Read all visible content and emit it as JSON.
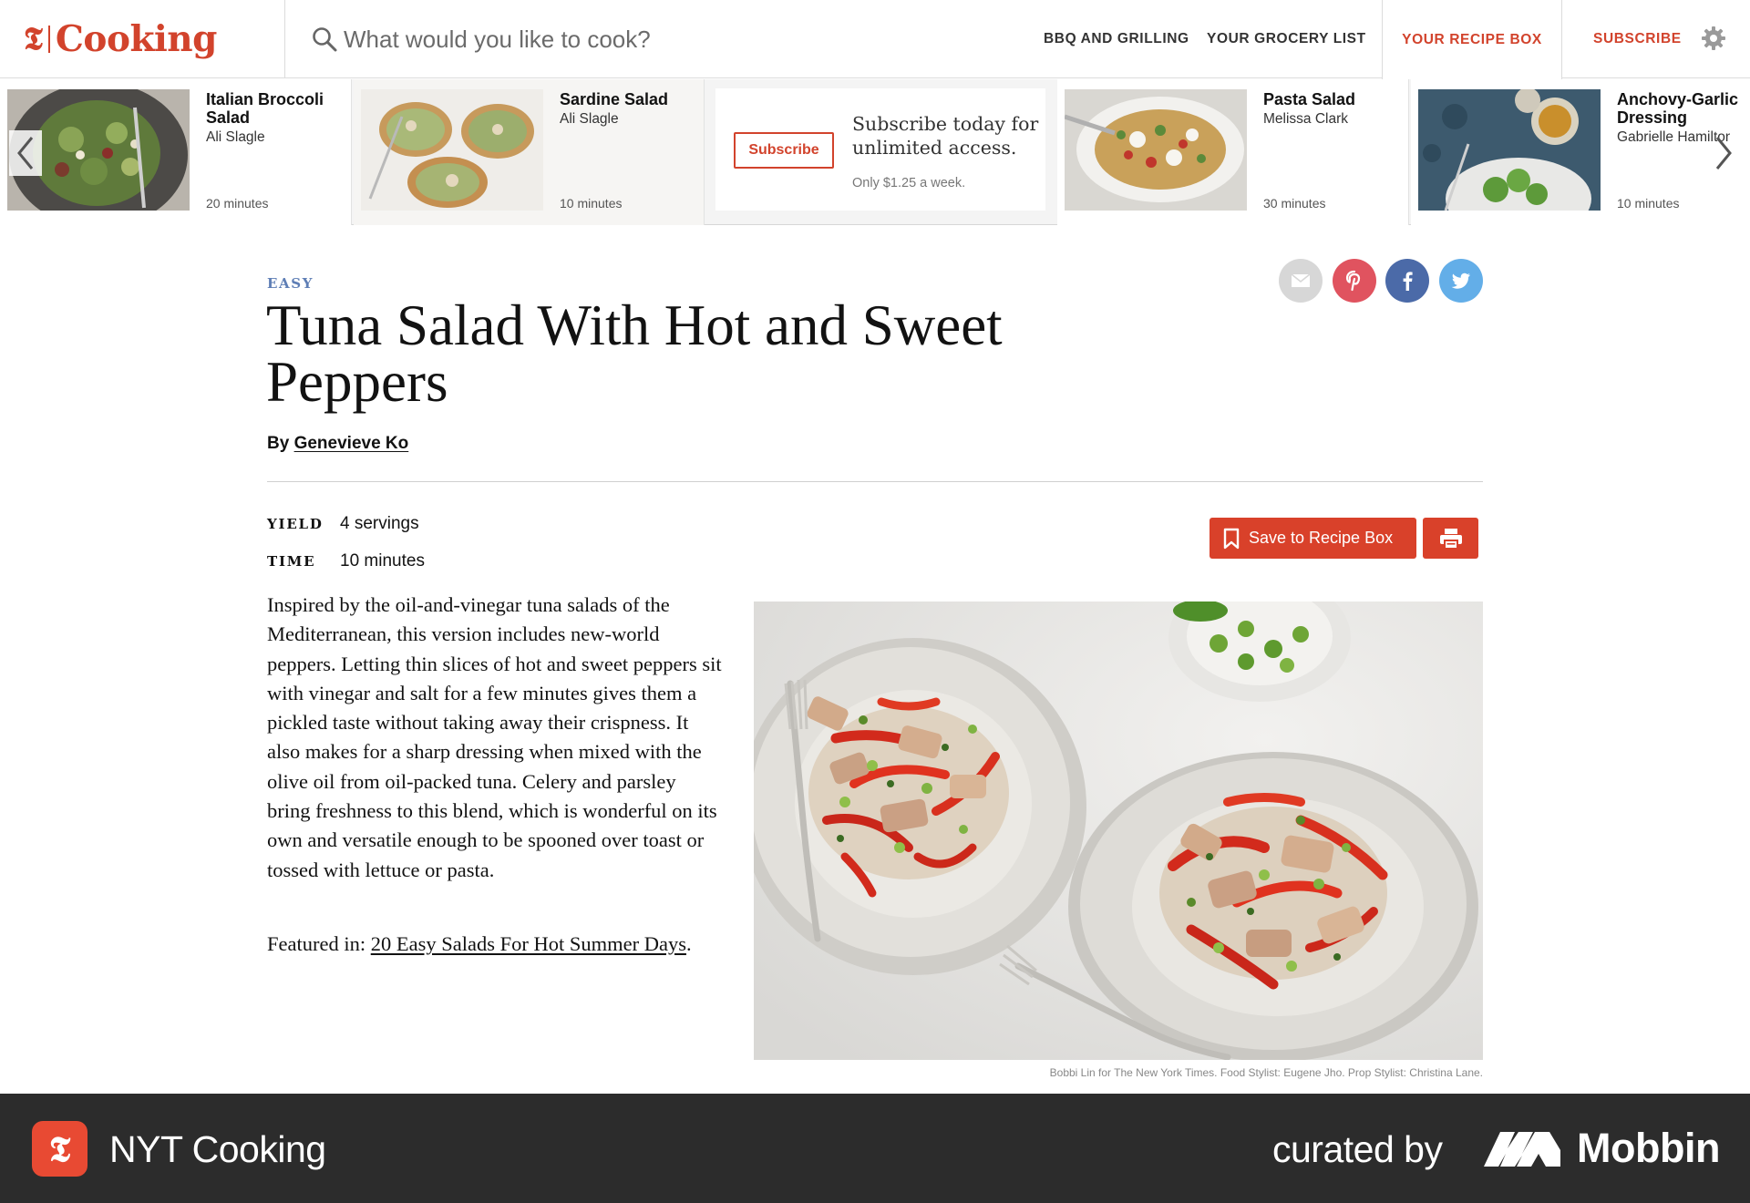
{
  "header": {
    "logo_mark": "𝕿",
    "logo_word": "Cooking",
    "search_placeholder": "What would you like to cook?",
    "nav": {
      "bbq": "BBQ AND GRILLING",
      "grocery": "YOUR GROCERY LIST",
      "recipe_box": "YOUR RECIPE BOX",
      "subscribe": "SUBSCRIBE"
    },
    "icons": {
      "search": "search-icon",
      "settings": "gear-icon"
    },
    "accent_color": "#d2432c"
  },
  "carousel": {
    "cards": [
      {
        "title": "Italian Broccoli Salad",
        "author": "Ali Slagle",
        "time": "20 minutes"
      },
      {
        "title": "Sardine Salad",
        "author": "Ali Slagle",
        "time": "10 minutes"
      },
      {
        "title": "Pasta Salad",
        "author": "Melissa Clark",
        "time": "30 minutes"
      },
      {
        "title": "Anchovy-Garlic Dressing",
        "author": "Gabrielle Hamilton",
        "time": "10 minutes"
      }
    ],
    "promo": {
      "button": "Subscribe",
      "headline": "Subscribe today for unlimited access.",
      "price": "Only $1.25 a week."
    }
  },
  "recipe": {
    "difficulty": "EASY",
    "title": "Tuna Salad With Hot and Sweet Peppers",
    "by_label": "By",
    "author": "Genevieve Ko",
    "yield_label": "YIELD",
    "yield_value": "4 servings",
    "time_label": "TIME",
    "time_value": "10 minutes",
    "save_button": "Save to Recipe Box",
    "description": "Inspired by the oil-and-vinegar tuna salads of the Mediterranean, this version includes new-world peppers. Letting thin slices of hot and sweet peppers sit with vinegar and salt for a few minutes gives them a pickled taste without taking away their crispness. It also makes for a sharp dressing when mixed with the olive oil from oil-packed tuna. Celery and parsley bring freshness to this blend, which is wonderful on its own and versatile enough to be spooned over toast or tossed with lettuce or pasta.",
    "featured_label": "Featured in:",
    "featured_link": "20 Easy Salads For Hot Summer Days",
    "featured_end": ".",
    "photo_credit": "Bobbi Lin for The New York Times. Food Stylist: Eugene Jho. Prop Stylist: Christina Lane.",
    "share_icons": [
      "email-icon",
      "pinterest-icon",
      "facebook-icon",
      "twitter-icon"
    ]
  },
  "footer": {
    "app_name": "NYT Cooking",
    "curated_by": "curated by",
    "brand": "Mobbin"
  }
}
